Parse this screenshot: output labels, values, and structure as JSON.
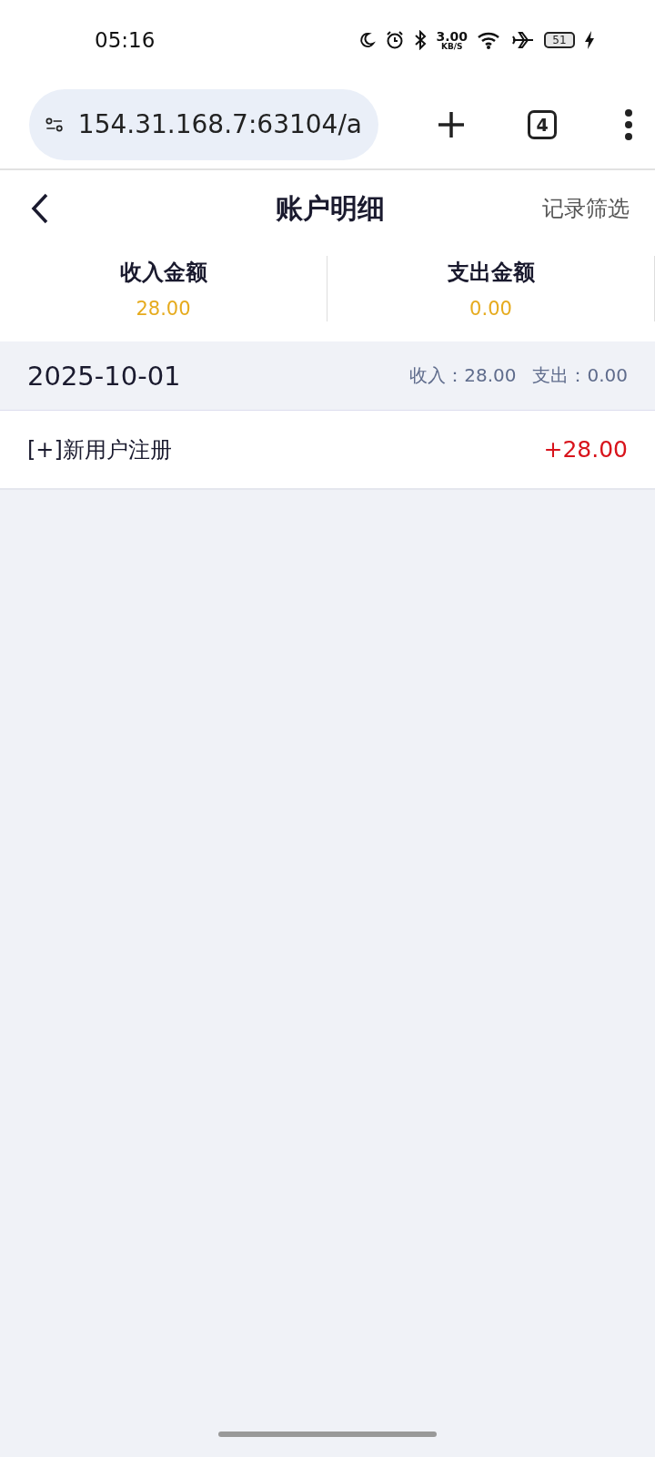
{
  "status_bar": {
    "time": "05:16",
    "speed_value": "3.00",
    "speed_unit": "KB/S",
    "battery": "51"
  },
  "browser": {
    "url": "154.31.168.7:63104/a",
    "tab_count": "4"
  },
  "header": {
    "title": "账户明细",
    "action": "记录筛选"
  },
  "summary": [
    {
      "label": "收入金额",
      "value": "28.00"
    },
    {
      "label": "支出金额",
      "value": "0.00"
    }
  ],
  "groups": [
    {
      "date": "2025-10-01",
      "income": "收入：28.00",
      "expense": "支出：0.00",
      "entries": [
        {
          "title": "[+]新用户注册",
          "amount": "+28.00",
          "kind": "income"
        }
      ]
    }
  ]
}
